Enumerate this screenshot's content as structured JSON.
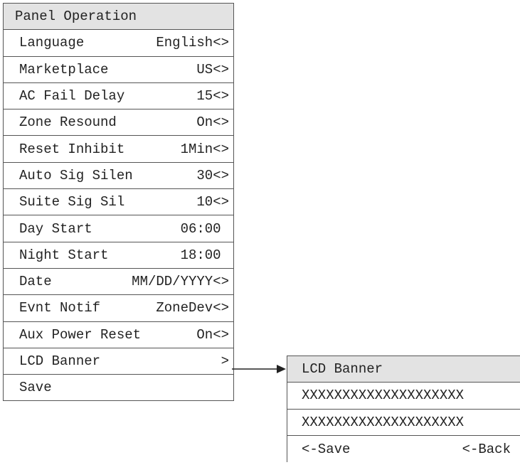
{
  "main_menu": {
    "title": "Panel Operation",
    "items": [
      {
        "label": "Language",
        "value": "English<>"
      },
      {
        "label": "Marketplace",
        "value": "US<>"
      },
      {
        "label": "AC Fail Delay",
        "value": "15<>"
      },
      {
        "label": "Zone Resound",
        "value": "On<>"
      },
      {
        "label": "Reset Inhibit",
        "value": "1Min<>"
      },
      {
        "label": "Auto Sig Silen",
        "value": "30<>"
      },
      {
        "label": "Suite Sig Sil",
        "value": "10<>"
      },
      {
        "label": "Day Start",
        "value": "06:00 "
      },
      {
        "label": "Night Start",
        "value": "18:00 "
      },
      {
        "label": "Date",
        "value": "MM/DD/YYYY<>"
      },
      {
        "label": "Evnt Notif",
        "value": "ZoneDev<>"
      },
      {
        "label": "Aux Power Reset",
        "value": "On<>"
      },
      {
        "label": "LCD Banner",
        "value": ">"
      },
      {
        "label": "Save",
        "value": ""
      }
    ]
  },
  "banner_menu": {
    "title": "LCD Banner",
    "line1": "XXXXXXXXXXXXXXXXXXXX",
    "line2": "XXXXXXXXXXXXXXXXXXXX",
    "save_label": "<-Save",
    "back_label": "<-Back"
  },
  "colors": {
    "header_bg": "#e3e3e3",
    "border": "#555555",
    "text": "#222222"
  }
}
